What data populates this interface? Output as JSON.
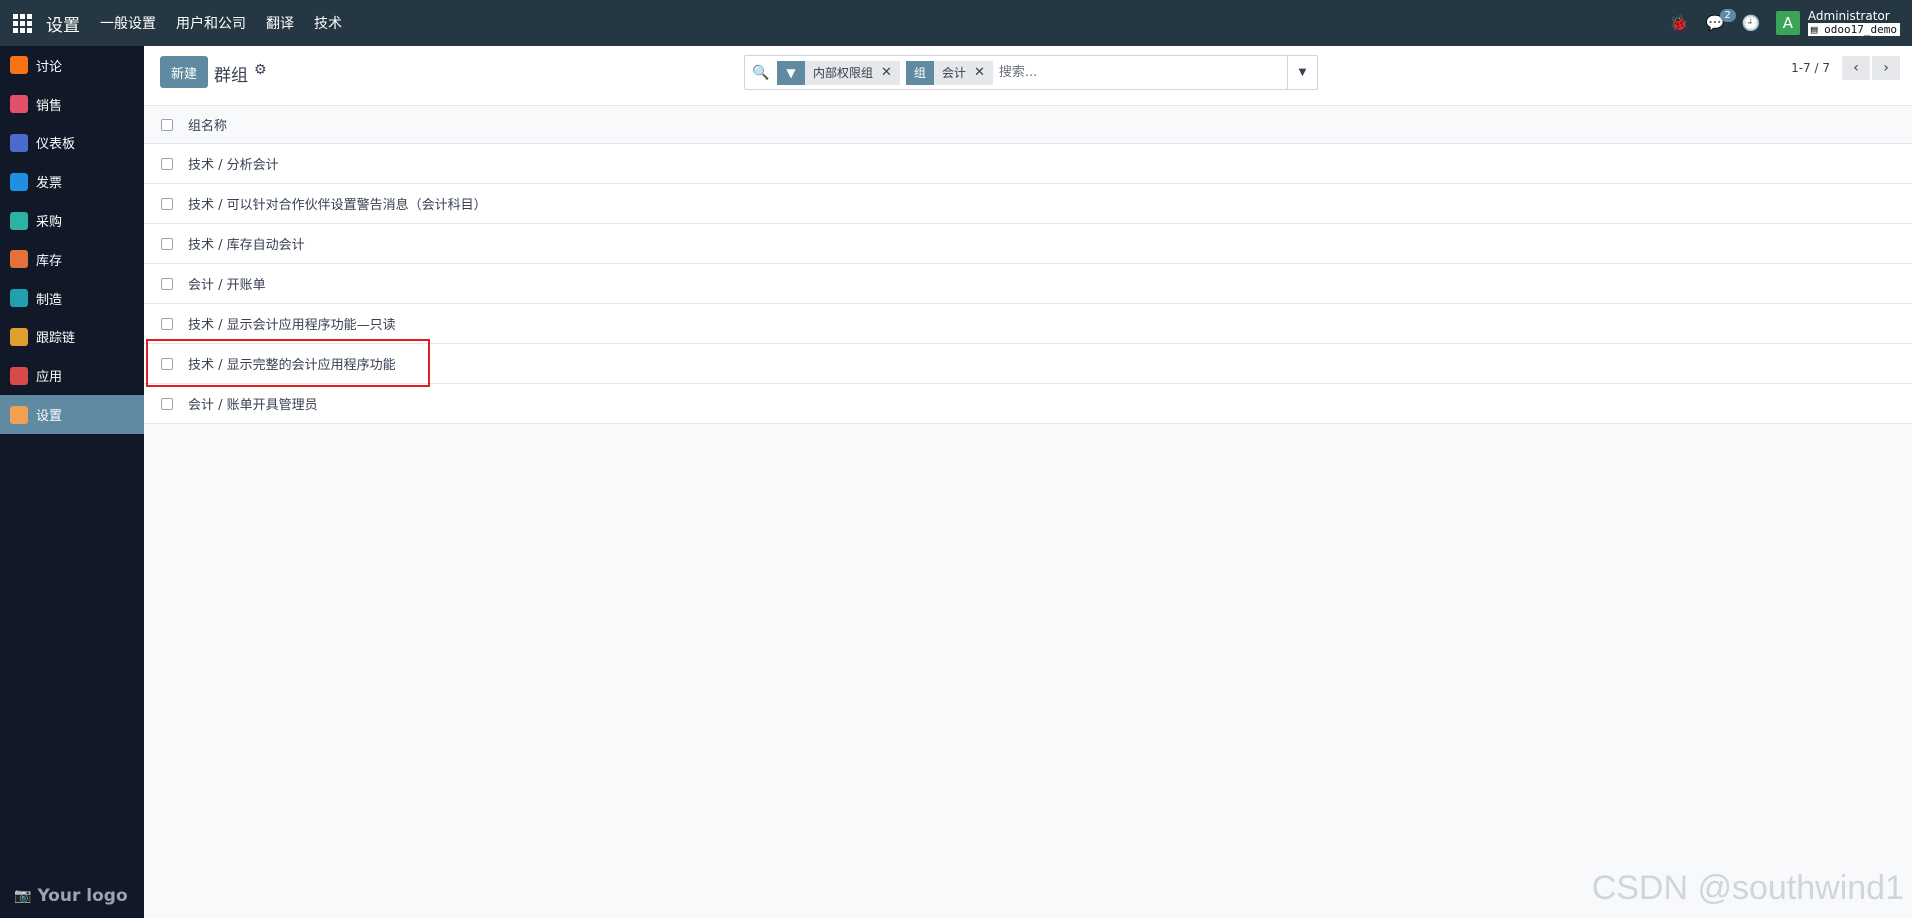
{
  "topbar": {
    "brand": "设置",
    "menu": [
      "一般设置",
      "用户和公司",
      "翻译",
      "技术"
    ],
    "chat_badge": "2",
    "avatar_letter": "A",
    "user_name": "Administrator",
    "db_name": "odoo17_demo"
  },
  "sidebar": {
    "items": [
      {
        "label": "讨论",
        "color": "#f97316"
      },
      {
        "label": "销售",
        "color": "#e0516a"
      },
      {
        "label": "仪表板",
        "color": "#4b6bd1"
      },
      {
        "label": "发票",
        "color": "#1f8fe0"
      },
      {
        "label": "采购",
        "color": "#2bb3a3"
      },
      {
        "label": "库存",
        "color": "#e5703a"
      },
      {
        "label": "制造",
        "color": "#22a0b0"
      },
      {
        "label": "跟踪链",
        "color": "#e0a030"
      },
      {
        "label": "应用",
        "color": "#d94a4a"
      },
      {
        "label": "设置",
        "color": "#f0a050"
      }
    ],
    "logo_text": "Your logo"
  },
  "control": {
    "new_label": "新建",
    "title": "群组",
    "facets": [
      {
        "tag": "▼",
        "value": "内部权限组"
      },
      {
        "tag": "组",
        "value": "会计"
      }
    ],
    "search_placeholder": "搜索...",
    "pager": "1-7 / 7"
  },
  "list": {
    "header": "组名称",
    "rows": [
      "技术 / 分析会计",
      "技术 / 可以针对合作伙伴设置警告消息（会计科目）",
      "技术 / 库存自动会计",
      "会计 / 开账单",
      "技术 / 显示会计应用程序功能—只读",
      "技术 / 显示完整的会计应用程序功能",
      "会计 / 账单开具管理员"
    ]
  },
  "watermark": "CSDN @southwind1"
}
